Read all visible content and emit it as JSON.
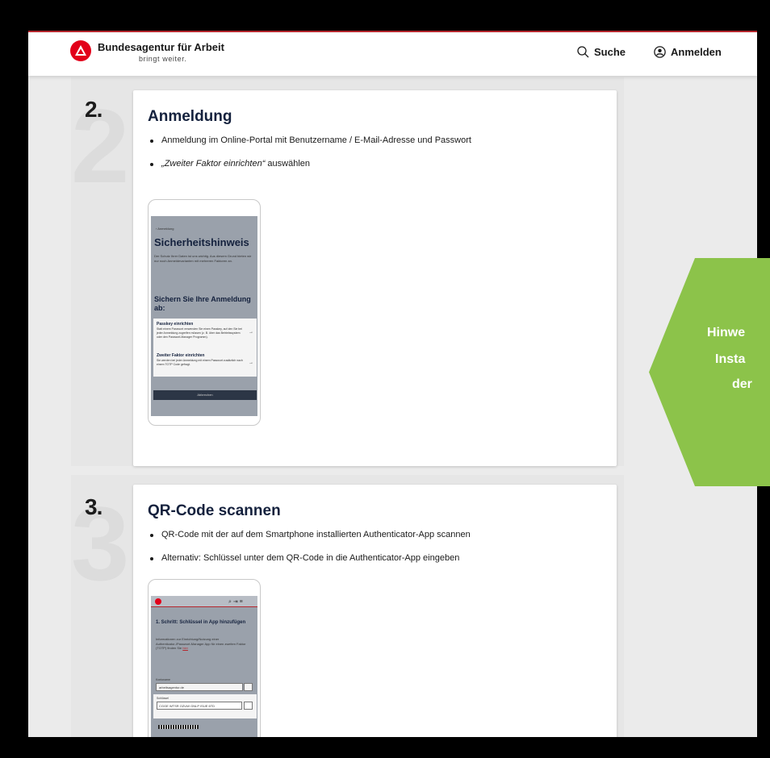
{
  "header": {
    "brand_name": "Bundesagentur für Arbeit",
    "brand_tagline": "bringt weiter.",
    "search_label": "Suche",
    "login_label": "Anmelden"
  },
  "steps": [
    {
      "number": "2.",
      "title": "Anmeldung",
      "bullets": [
        {
          "text": "Anmeldung im Online-Portal mit Benutzername / E-Mail-Adresse und Passwort"
        },
        {
          "italic": "„Zweiter Faktor einrichten“",
          "text": " auswählen"
        }
      ],
      "phone": {
        "back_link": "‹ Anmeldung",
        "heading": "Sicherheitshinweis",
        "intro": "Der Schutz Ihrer Daten ist uns wichtig. Aus diesem Grund bieten wir nur noch Anmeldevarianten mit mehreren Faktoren an.",
        "subheading": "Sichern Sie Ihre Anmeldung ab:",
        "option1_title": "Passkey einrichten",
        "option1_desc": "Statt einem Passwort verwenden Sie einen Passkey, auf den Sie bei jeder Anmeldung zugreifen müssen (z. B. über das Betriebssystem oder den Passwort-Manager Programm).",
        "option2_title": "Zweiter Faktor einrichten",
        "option2_desc": "Sie werden bei jeder Anmeldung mit einem Passwort zusätzlich nach einem TOTP Code gefragt.",
        "cancel_label": "Abbrechen"
      }
    },
    {
      "number": "3.",
      "title": "QR-Code scannen",
      "bullets": [
        {
          "text": "QR-Code mit der auf dem Smartphone installierten Authenticator-App scannen"
        },
        {
          "text": "Alternativ: Schlüssel unter dem QR-Code in die Authenticator-App eingeben"
        }
      ],
      "phone": {
        "heading": "1. Schritt: Schlüssel in App hinzufügen",
        "intro": "Informationen zur Einrichtung/Nutzung einer Authenticator-/Passwort-Manager App für einen zweiten Faktor (TOTP) finden Sie ",
        "intro_link": "hier",
        "account_label": "Kontoname",
        "account_value": "arbeitsagentur.de",
        "key_label": "Schlüssel",
        "key_value": "CGGE WTSR OZUW GNLP ISUE 6TD"
      }
    }
  ],
  "hint": {
    "line1": "Hinwe",
    "line2": "Insta",
    "line3": "der"
  },
  "colors": {
    "brand_red": "#e2001a",
    "hint_green": "#8cc34a",
    "title_navy": "#14213d"
  }
}
